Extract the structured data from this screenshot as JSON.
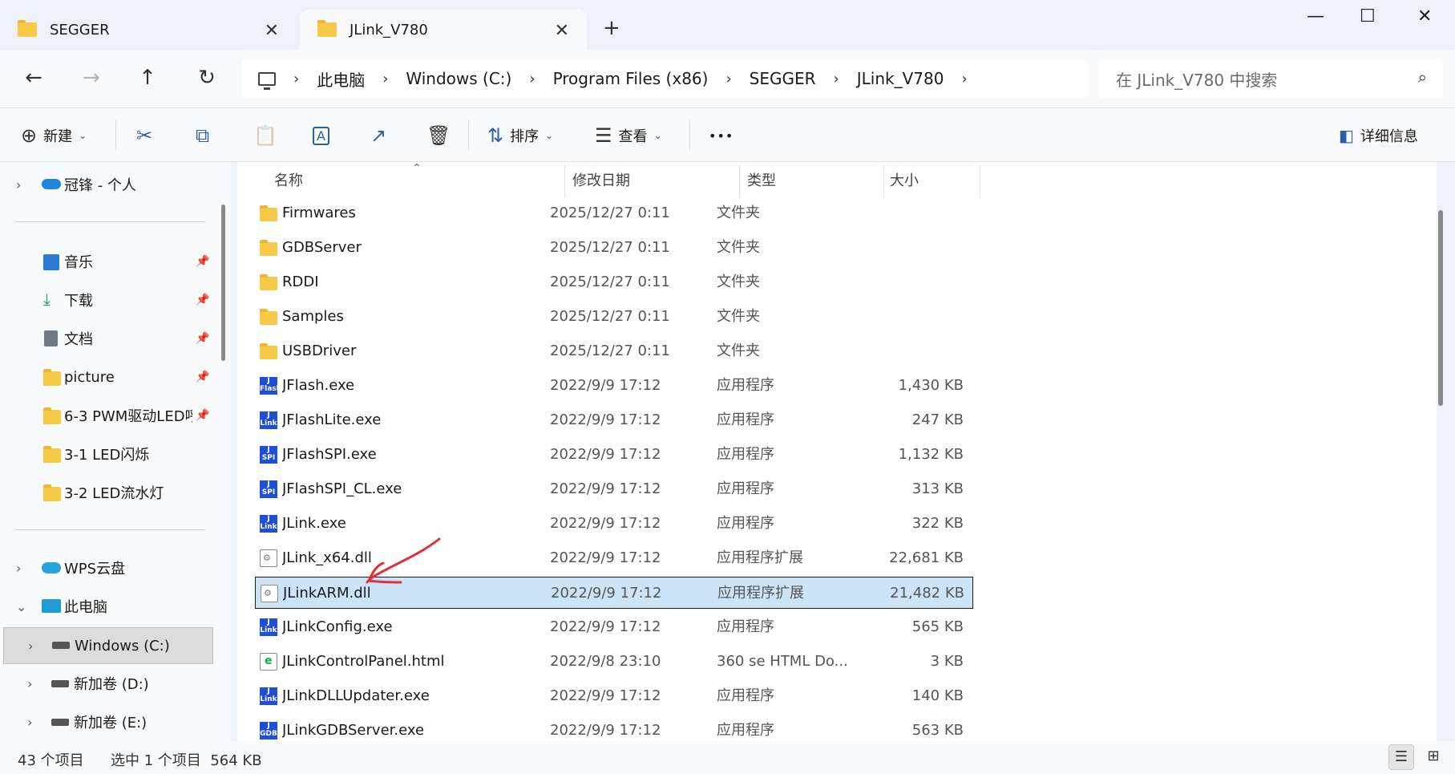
{
  "tabs": [
    {
      "label": "SEGGER",
      "close": "✕"
    },
    {
      "label": "JLink_V780",
      "close": "✕"
    }
  ],
  "new_tab": "+",
  "window_controls": {
    "minimize": "—",
    "maximize": "☐",
    "close": "✕"
  },
  "nav": {
    "back": "←",
    "forward": "→",
    "up": "↑",
    "refresh": "↻"
  },
  "breadcrumb": {
    "separator": "›",
    "items": [
      "此电脑",
      "Windows (C:)",
      "Program Files (x86)",
      "SEGGER",
      "JLink_V780"
    ]
  },
  "search": {
    "placeholder": "在 JLink_V780 中搜索",
    "icon": "search-icon"
  },
  "toolbar": {
    "new_label": "新建",
    "sort_label": "排序",
    "view_label": "查看",
    "more_label": "•••",
    "details_label": "详细信息",
    "icons": {
      "new": "⊕",
      "cut": "✂",
      "copy": "⧉",
      "paste": "📋",
      "rename": "A",
      "share": "↗",
      "delete": "🗑",
      "sort": "⇅",
      "view": "☰"
    }
  },
  "sidebar": {
    "items": [
      {
        "label": "冠锋 - 个人",
        "icon": "onedrive-icon",
        "has_chevron": true
      },
      {
        "label": "音乐",
        "icon": "music-icon",
        "pinned": true
      },
      {
        "label": "下载",
        "icon": "download-icon",
        "pinned": true
      },
      {
        "label": "文档",
        "icon": "document-icon",
        "pinned": true
      },
      {
        "label": "picture",
        "icon": "folder-icon",
        "pinned": true
      },
      {
        "label": "6-3 PWM驱动LED呼",
        "icon": "folder-icon",
        "pinned": true
      },
      {
        "label": "3-1 LED闪烁",
        "icon": "folder-icon"
      },
      {
        "label": "3-2 LED流水灯",
        "icon": "folder-icon"
      },
      {
        "label": "WPS云盘",
        "icon": "cloud-icon",
        "has_chevron": true
      },
      {
        "label": "此电脑",
        "icon": "computer-icon",
        "has_chevron": true,
        "expanded": true
      },
      {
        "label": "Windows (C:)",
        "icon": "drive-icon",
        "has_chevron": true,
        "selected": true
      },
      {
        "label": "新加卷 (D:)",
        "icon": "drive-icon",
        "has_chevron": true
      },
      {
        "label": "新加卷 (E:)",
        "icon": "drive-icon",
        "has_chevron": true
      }
    ]
  },
  "columns": {
    "name": "名称",
    "date": "修改日期",
    "type": "类型",
    "size": "大小"
  },
  "files": [
    {
      "name": "Firmwares",
      "date": "2025/12/27 0:11",
      "type": "文件夹",
      "size": "",
      "icon": "folder"
    },
    {
      "name": "GDBServer",
      "date": "2025/12/27 0:11",
      "type": "文件夹",
      "size": "",
      "icon": "folder"
    },
    {
      "name": "RDDI",
      "date": "2025/12/27 0:11",
      "type": "文件夹",
      "size": "",
      "icon": "folder"
    },
    {
      "name": "Samples",
      "date": "2025/12/27 0:11",
      "type": "文件夹",
      "size": "",
      "icon": "folder"
    },
    {
      "name": "USBDriver",
      "date": "2025/12/27 0:11",
      "type": "文件夹",
      "size": "",
      "icon": "folder"
    },
    {
      "name": "JFlash.exe",
      "date": "2022/9/9 17:12",
      "type": "应用程序",
      "size": "1,430 KB",
      "icon": "exe"
    },
    {
      "name": "JFlashLite.exe",
      "date": "2022/9/9 17:12",
      "type": "应用程序",
      "size": "247 KB",
      "icon": "exe"
    },
    {
      "name": "JFlashSPI.exe",
      "date": "2022/9/9 17:12",
      "type": "应用程序",
      "size": "1,132 KB",
      "icon": "exe"
    },
    {
      "name": "JFlashSPI_CL.exe",
      "date": "2022/9/9 17:12",
      "type": "应用程序",
      "size": "313 KB",
      "icon": "exe"
    },
    {
      "name": "JLink.exe",
      "date": "2022/9/9 17:12",
      "type": "应用程序",
      "size": "322 KB",
      "icon": "exe"
    },
    {
      "name": "JLink_x64.dll",
      "date": "2022/9/9 17:12",
      "type": "应用程序扩展",
      "size": "22,681 KB",
      "icon": "dll"
    },
    {
      "name": "JLinkARM.dll",
      "date": "2022/9/9 17:12",
      "type": "应用程序扩展",
      "size": "21,482 KB",
      "icon": "dll",
      "selected": true
    },
    {
      "name": "JLinkConfig.exe",
      "date": "2022/9/9 17:12",
      "type": "应用程序",
      "size": "565 KB",
      "icon": "exe"
    },
    {
      "name": "JLinkControlPanel.html",
      "date": "2022/9/8 23:10",
      "type": "360 se HTML Do...",
      "size": "3 KB",
      "icon": "html"
    },
    {
      "name": "JLinkDLLUpdater.exe",
      "date": "2022/9/9 17:12",
      "type": "应用程序",
      "size": "140 KB",
      "icon": "exe"
    },
    {
      "name": "JLinkGDBServer.exe",
      "date": "2022/9/9 17:12",
      "type": "应用程序",
      "size": "563 KB",
      "icon": "exe"
    }
  ],
  "status": {
    "count": "43 个项目",
    "selection": "选中 1 个项目  564 KB"
  },
  "colors": {
    "selection_bg": "#cce4f7",
    "accent": "#2c5ea8",
    "annotation": "#e0303a"
  }
}
